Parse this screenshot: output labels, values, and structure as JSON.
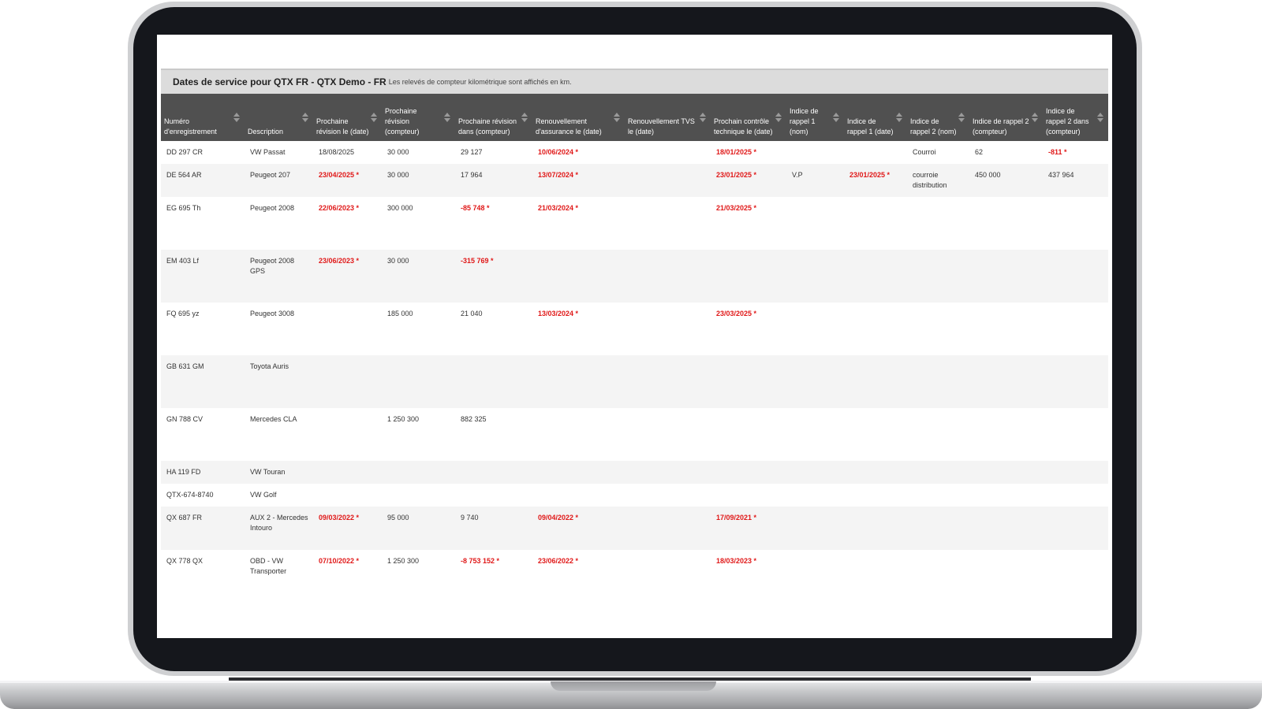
{
  "page": {
    "title": "Dates de service pour QTX FR - QTX Demo - FR",
    "note": "Les relevés de compteur kilométrique sont affichés en km."
  },
  "columns": [
    {
      "label": "Numéro d'enregistrement"
    },
    {
      "label": "Description"
    },
    {
      "label": "Prochaine révision le (date)"
    },
    {
      "label": "Prochaine révision (compteur)"
    },
    {
      "label": "Prochaine révision dans (compteur)"
    },
    {
      "label": "Renouvellement d'assurance le (date)"
    },
    {
      "label": "Renouvellement TVS le (date)"
    },
    {
      "label": "Prochain contrôle technique le (date)"
    },
    {
      "label": "Indice de rappel 1 (nom)"
    },
    {
      "label": "Indice de rappel 1 (date)"
    },
    {
      "label": "Indice de rappel 2 (nom)"
    },
    {
      "label": "Indice de rappel 2 (compteur)"
    },
    {
      "label": "Indice de rappel 2 dans (compteur)"
    }
  ],
  "rows": [
    {
      "cells": [
        {
          "text": "DD 297 CR"
        },
        {
          "text": "VW Passat"
        },
        {
          "text": "18/08/2025"
        },
        {
          "text": "30 000"
        },
        {
          "text": "29 127"
        },
        {
          "text": "10/06/2024 *",
          "overdue": true
        },
        {
          "text": ""
        },
        {
          "text": "18/01/2025 *",
          "overdue": true
        },
        {
          "text": ""
        },
        {
          "text": ""
        },
        {
          "text": "Courroi"
        },
        {
          "text": "62"
        },
        {
          "text": "-811 *",
          "overdue": true
        }
      ]
    },
    {
      "cells": [
        {
          "text": "DE 564 AR"
        },
        {
          "text": "Peugeot 207"
        },
        {
          "text": "23/04/2025 *",
          "overdue": true
        },
        {
          "text": "30 000"
        },
        {
          "text": "17 964"
        },
        {
          "text": "13/07/2024 *",
          "overdue": true
        },
        {
          "text": ""
        },
        {
          "text": "23/01/2025 *",
          "overdue": true
        },
        {
          "text": "V.P"
        },
        {
          "text": "23/01/2025 *",
          "overdue": true
        },
        {
          "text": "courroie distribution"
        },
        {
          "text": "450 000"
        },
        {
          "text": "437 964"
        }
      ]
    },
    {
      "cells": [
        {
          "text": "EG 695 Th"
        },
        {
          "text": "Peugeot 2008"
        },
        {
          "text": "22/06/2023 *",
          "overdue": true
        },
        {
          "text": "300 000"
        },
        {
          "text": "-85 748 *",
          "overdue": true
        },
        {
          "text": "21/03/2024 *",
          "overdue": true
        },
        {
          "text": ""
        },
        {
          "text": "21/03/2025 *",
          "overdue": true
        },
        {
          "text": ""
        },
        {
          "text": ""
        },
        {
          "text": ""
        },
        {
          "text": ""
        },
        {
          "text": ""
        }
      ]
    },
    {
      "cells": [
        {
          "text": "EM 403 Lf"
        },
        {
          "text": "Peugeot 2008 GPS"
        },
        {
          "text": "23/06/2023 *",
          "overdue": true
        },
        {
          "text": "30 000"
        },
        {
          "text": "-315 769 *",
          "overdue": true
        },
        {
          "text": ""
        },
        {
          "text": ""
        },
        {
          "text": ""
        },
        {
          "text": ""
        },
        {
          "text": ""
        },
        {
          "text": ""
        },
        {
          "text": ""
        },
        {
          "text": ""
        }
      ]
    },
    {
      "cells": [
        {
          "text": "FQ 695 yz"
        },
        {
          "text": "Peugeot 3008"
        },
        {
          "text": ""
        },
        {
          "text": "185 000"
        },
        {
          "text": "21 040"
        },
        {
          "text": "13/03/2024 *",
          "overdue": true
        },
        {
          "text": ""
        },
        {
          "text": "23/03/2025 *",
          "overdue": true
        },
        {
          "text": ""
        },
        {
          "text": ""
        },
        {
          "text": ""
        },
        {
          "text": ""
        },
        {
          "text": ""
        }
      ]
    },
    {
      "cells": [
        {
          "text": "GB 631 GM"
        },
        {
          "text": "Toyota Auris"
        },
        {
          "text": ""
        },
        {
          "text": ""
        },
        {
          "text": ""
        },
        {
          "text": ""
        },
        {
          "text": ""
        },
        {
          "text": ""
        },
        {
          "text": ""
        },
        {
          "text": ""
        },
        {
          "text": ""
        },
        {
          "text": ""
        },
        {
          "text": ""
        }
      ]
    },
    {
      "cells": [
        {
          "text": "GN 788 CV"
        },
        {
          "text": "Mercedes CLA"
        },
        {
          "text": ""
        },
        {
          "text": "1 250 300"
        },
        {
          "text": "882 325"
        },
        {
          "text": ""
        },
        {
          "text": ""
        },
        {
          "text": ""
        },
        {
          "text": ""
        },
        {
          "text": ""
        },
        {
          "text": ""
        },
        {
          "text": ""
        },
        {
          "text": ""
        }
      ]
    },
    {
      "cells": [
        {
          "text": "HA 119 FD"
        },
        {
          "text": "VW Touran"
        },
        {
          "text": ""
        },
        {
          "text": ""
        },
        {
          "text": ""
        },
        {
          "text": ""
        },
        {
          "text": ""
        },
        {
          "text": ""
        },
        {
          "text": ""
        },
        {
          "text": ""
        },
        {
          "text": ""
        },
        {
          "text": ""
        },
        {
          "text": ""
        }
      ]
    },
    {
      "cells": [
        {
          "text": "QTX-674-8740"
        },
        {
          "text": "VW Golf"
        },
        {
          "text": ""
        },
        {
          "text": ""
        },
        {
          "text": ""
        },
        {
          "text": ""
        },
        {
          "text": ""
        },
        {
          "text": ""
        },
        {
          "text": ""
        },
        {
          "text": ""
        },
        {
          "text": ""
        },
        {
          "text": ""
        },
        {
          "text": ""
        }
      ]
    },
    {
      "cells": [
        {
          "text": "QX 687 FR"
        },
        {
          "text": "AUX 2 - Mercedes Intouro"
        },
        {
          "text": "09/03/2022 *",
          "overdue": true
        },
        {
          "text": "95 000"
        },
        {
          "text": "9 740"
        },
        {
          "text": "09/04/2022 *",
          "overdue": true
        },
        {
          "text": ""
        },
        {
          "text": "17/09/2021 *",
          "overdue": true
        },
        {
          "text": ""
        },
        {
          "text": ""
        },
        {
          "text": ""
        },
        {
          "text": ""
        },
        {
          "text": ""
        }
      ]
    },
    {
      "cells": [
        {
          "text": "QX 778 QX"
        },
        {
          "text": "OBD - VW Transporter"
        },
        {
          "text": "07/10/2022 *",
          "overdue": true
        },
        {
          "text": "1 250 300"
        },
        {
          "text": "-8 753 152 *",
          "overdue": true
        },
        {
          "text": "23/06/2022 *",
          "overdue": true
        },
        {
          "text": ""
        },
        {
          "text": "18/03/2023 *",
          "overdue": true
        },
        {
          "text": ""
        },
        {
          "text": ""
        },
        {
          "text": ""
        },
        {
          "text": ""
        },
        {
          "text": ""
        }
      ]
    }
  ],
  "colors": {
    "header_bg": "#505050",
    "title_bar_bg": "#dcdcdc",
    "overdue_text": "#e01818",
    "bezel": "#15171c"
  },
  "icons": {
    "sort": "sort-arrows-icon"
  }
}
